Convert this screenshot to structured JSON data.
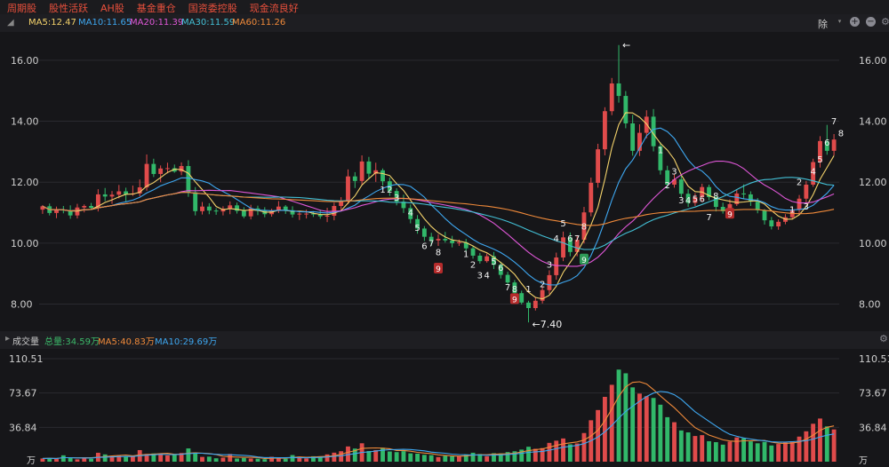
{
  "tags": [
    "周期股",
    "股性活跃",
    "AH股",
    "基金重仓",
    "国资委控股",
    "现金流良好"
  ],
  "ma_legend": [
    {
      "label": "MA5:12.47",
      "color": "#f5d36b"
    },
    {
      "label": "MA10:11.65",
      "color": "#3ea7f0"
    },
    {
      "label": "MA20:11.39",
      "color": "#e057d8"
    },
    {
      "label": "MA30:11.59",
      "color": "#43c0d6"
    },
    {
      "label": "MA60:11.26",
      "color": "#f08a3a"
    }
  ],
  "toolbar": {
    "adjust_label": "除"
  },
  "volume_legend": {
    "title": "成交量",
    "items": [
      {
        "label": "总量:34.59万",
        "color": "#3cba6a"
      },
      {
        "label": "MA5:40.83万",
        "color": "#f08a3a"
      },
      {
        "label": "MA10:29.69万",
        "color": "#3ea7f0"
      }
    ]
  },
  "chart_data": {
    "type": "candlestick",
    "price_ticks": [
      "16.00",
      "14.00",
      "12.00",
      "10.00",
      "8.00"
    ],
    "price_range": [
      7.2,
      16.9
    ],
    "volume_ticks": [
      "110.51",
      "73.67",
      "36.84"
    ],
    "volume_unit": "万",
    "volume_range": [
      0,
      120
    ],
    "annotations": {
      "low": "←7.40",
      "high": "←"
    },
    "seq_labels": [
      {
        "i": 49,
        "p": 11.65,
        "t": "1"
      },
      {
        "i": 50,
        "p": 11.65,
        "t": "2"
      },
      {
        "i": 51,
        "p": 11.4,
        "t": "3"
      },
      {
        "i": 53,
        "p": 10.9,
        "t": "4"
      },
      {
        "i": 54,
        "p": 10.4,
        "t": "5"
      },
      {
        "i": 55,
        "p": 9.8,
        "t": "6"
      },
      {
        "i": 56,
        "p": 9.9,
        "t": "7"
      },
      {
        "i": 57,
        "p": 9.6,
        "t": "8"
      },
      {
        "i": 61,
        "p": 9.55,
        "t": "1"
      },
      {
        "i": 62,
        "p": 9.2,
        "t": "2"
      },
      {
        "i": 63,
        "p": 8.85,
        "t": "3"
      },
      {
        "i": 64,
        "p": 8.85,
        "t": "4"
      },
      {
        "i": 65,
        "p": 9.3,
        "t": "5"
      },
      {
        "i": 66,
        "p": 9.1,
        "t": "6"
      },
      {
        "i": 67,
        "p": 8.45,
        "t": "7"
      },
      {
        "i": 68,
        "p": 8.4,
        "t": "8"
      },
      {
        "i": 70,
        "p": 8.4,
        "t": "1"
      },
      {
        "i": 72,
        "p": 8.55,
        "t": "2"
      },
      {
        "i": 73,
        "p": 9.2,
        "t": "3"
      },
      {
        "i": 74,
        "p": 10.05,
        "t": "4"
      },
      {
        "i": 75,
        "p": 10.55,
        "t": "5"
      },
      {
        "i": 76,
        "p": 10.05,
        "t": "6"
      },
      {
        "i": 77,
        "p": 10.05,
        "t": "7"
      },
      {
        "i": 78,
        "p": 10.45,
        "t": "8"
      },
      {
        "i": 89,
        "p": 12.95,
        "t": "1"
      },
      {
        "i": 90,
        "p": 11.8,
        "t": "2"
      },
      {
        "i": 91,
        "p": 12.25,
        "t": "3"
      },
      {
        "i": 92,
        "p": 11.3,
        "t": "3"
      },
      {
        "i": 93,
        "p": 11.3,
        "t": "4"
      },
      {
        "i": 94,
        "p": 11.35,
        "t": "5"
      },
      {
        "i": 95,
        "p": 11.35,
        "t": "6"
      },
      {
        "i": 96,
        "p": 10.75,
        "t": "7"
      },
      {
        "i": 97,
        "p": 11.45,
        "t": "8"
      },
      {
        "i": 108,
        "p": 11.0,
        "t": "1"
      },
      {
        "i": 109,
        "p": 11.9,
        "t": "2"
      },
      {
        "i": 110,
        "p": 11.1,
        "t": "3"
      },
      {
        "i": 111,
        "p": 12.25,
        "t": "4"
      },
      {
        "i": 112,
        "p": 12.65,
        "t": "5"
      },
      {
        "i": 113,
        "p": 13.2,
        "t": "6"
      },
      {
        "i": 114,
        "p": 13.9,
        "t": "7"
      },
      {
        "i": 115,
        "p": 13.5,
        "t": "8"
      }
    ],
    "badge9": [
      {
        "i": 57,
        "p": 9.15,
        "c": "#b52b2b",
        "t": "9"
      },
      {
        "i": 68,
        "p": 8.15,
        "c": "#b52b2b",
        "t": "9"
      },
      {
        "i": 78,
        "p": 9.45,
        "c": "#2f9a58",
        "t": "9"
      },
      {
        "i": 99,
        "p": 10.95,
        "c": "#b52b2b",
        "t": "9"
      }
    ],
    "candles": [
      {
        "o": 11.1,
        "h": 11.25,
        "l": 10.96,
        "c": 11.21,
        "v": 3.42
      },
      {
        "o": 11.21,
        "h": 11.3,
        "l": 10.91,
        "c": 10.99,
        "v": 3.79
      },
      {
        "o": 10.99,
        "h": 11.2,
        "l": 10.82,
        "c": 11.1,
        "v": 3.15
      },
      {
        "o": 11.1,
        "h": 11.22,
        "l": 10.98,
        "c": 11.08,
        "v": 6.82
      },
      {
        "o": 11.08,
        "h": 11.24,
        "l": 10.8,
        "c": 10.91,
        "v": 4.12
      },
      {
        "o": 10.91,
        "h": 11.29,
        "l": 10.81,
        "c": 11.17,
        "v": 2.5
      },
      {
        "o": 11.17,
        "h": 11.27,
        "l": 11.01,
        "c": 11.22,
        "v": 4.37
      },
      {
        "o": 11.22,
        "h": 11.32,
        "l": 11.1,
        "c": 11.16,
        "v": 3.08
      },
      {
        "o": 11.16,
        "h": 11.77,
        "l": 11.04,
        "c": 11.6,
        "v": 9.55
      },
      {
        "o": 11.6,
        "h": 11.81,
        "l": 11.38,
        "c": 11.53,
        "v": 7.8
      },
      {
        "o": 11.53,
        "h": 11.71,
        "l": 11.29,
        "c": 11.59,
        "v": 5.93
      },
      {
        "o": 11.59,
        "h": 11.91,
        "l": 11.47,
        "c": 11.7,
        "v": 6.9
      },
      {
        "o": 11.7,
        "h": 11.82,
        "l": 11.37,
        "c": 11.6,
        "v": 5.31
      },
      {
        "o": 11.6,
        "h": 11.89,
        "l": 11.55,
        "c": 11.63,
        "v": 5.54
      },
      {
        "o": 11.63,
        "h": 12.09,
        "l": 11.53,
        "c": 11.83,
        "v": 12.4
      },
      {
        "o": 11.83,
        "h": 12.91,
        "l": 11.72,
        "c": 12.6,
        "v": 8.32
      },
      {
        "o": 12.6,
        "h": 12.77,
        "l": 12.17,
        "c": 12.27,
        "v": 8.84
      },
      {
        "o": 12.27,
        "h": 12.55,
        "l": 12.0,
        "c": 12.45,
        "v": 8.41
      },
      {
        "o": 12.45,
        "h": 12.64,
        "l": 12.29,
        "c": 12.46,
        "v": 6.73
      },
      {
        "o": 12.46,
        "h": 12.58,
        "l": 12.31,
        "c": 12.35,
        "v": 7.15
      },
      {
        "o": 12.35,
        "h": 12.65,
        "l": 12.23,
        "c": 12.53,
        "v": 9.29
      },
      {
        "o": 12.53,
        "h": 12.72,
        "l": 11.52,
        "c": 11.67,
        "v": 14.21
      },
      {
        "o": 11.67,
        "h": 11.84,
        "l": 10.91,
        "c": 11.05,
        "v": 9.87
      },
      {
        "o": 11.05,
        "h": 11.35,
        "l": 10.94,
        "c": 11.2,
        "v": 5.12
      },
      {
        "o": 11.2,
        "h": 11.31,
        "l": 10.95,
        "c": 11.07,
        "v": 5.43
      },
      {
        "o": 11.07,
        "h": 11.15,
        "l": 10.93,
        "c": 11.04,
        "v": 3.64
      },
      {
        "o": 11.04,
        "h": 11.21,
        "l": 10.91,
        "c": 11.13,
        "v": 4.32
      },
      {
        "o": 11.13,
        "h": 11.37,
        "l": 10.95,
        "c": 11.24,
        "v": 8.24
      },
      {
        "o": 11.24,
        "h": 11.33,
        "l": 10.97,
        "c": 11.06,
        "v": 3.37
      },
      {
        "o": 11.06,
        "h": 11.18,
        "l": 10.82,
        "c": 10.88,
        "v": 3.97
      },
      {
        "o": 10.88,
        "h": 11.26,
        "l": 10.78,
        "c": 11.14,
        "v": 3.41
      },
      {
        "o": 11.14,
        "h": 11.23,
        "l": 10.92,
        "c": 11.06,
        "v": 3.21
      },
      {
        "o": 11.06,
        "h": 11.18,
        "l": 10.85,
        "c": 10.95,
        "v": 2.7
      },
      {
        "o": 10.95,
        "h": 11.13,
        "l": 10.87,
        "c": 11.06,
        "v": 5.23
      },
      {
        "o": 11.06,
        "h": 11.38,
        "l": 10.99,
        "c": 11.2,
        "v": 4.14
      },
      {
        "o": 11.2,
        "h": 11.25,
        "l": 10.96,
        "c": 11.08,
        "v": 3.15
      },
      {
        "o": 11.08,
        "h": 11.21,
        "l": 10.84,
        "c": 10.94,
        "v": 7.1
      },
      {
        "o": 10.94,
        "h": 11.05,
        "l": 10.76,
        "c": 10.97,
        "v": 5.41
      },
      {
        "o": 10.97,
        "h": 11.1,
        "l": 10.81,
        "c": 10.97,
        "v": 3.54
      },
      {
        "o": 10.97,
        "h": 11.05,
        "l": 10.86,
        "c": 10.95,
        "v": 5.8
      },
      {
        "o": 10.95,
        "h": 11.1,
        "l": 10.8,
        "c": 10.88,
        "v": 5.34
      },
      {
        "o": 10.88,
        "h": 11.16,
        "l": 10.69,
        "c": 10.9,
        "v": 7.8
      },
      {
        "o": 10.9,
        "h": 11.33,
        "l": 10.75,
        "c": 11.22,
        "v": 9.66
      },
      {
        "o": 11.22,
        "h": 11.51,
        "l": 11.09,
        "c": 11.39,
        "v": 11.2
      },
      {
        "o": 11.39,
        "h": 12.42,
        "l": 11.28,
        "c": 12.19,
        "v": 16.32
      },
      {
        "o": 12.19,
        "h": 12.33,
        "l": 11.81,
        "c": 12.04,
        "v": 14.07
      },
      {
        "o": 12.04,
        "h": 12.88,
        "l": 11.92,
        "c": 12.68,
        "v": 19.74
      },
      {
        "o": 12.68,
        "h": 12.83,
        "l": 12.09,
        "c": 12.28,
        "v": 11.42
      },
      {
        "o": 12.28,
        "h": 12.64,
        "l": 12.01,
        "c": 12.39,
        "v": 12.41
      },
      {
        "o": 12.39,
        "h": 12.45,
        "l": 11.89,
        "c": 12.03,
        "v": 14.92
      },
      {
        "o": 12.03,
        "h": 12.15,
        "l": 11.55,
        "c": 11.71,
        "v": 10.93
      },
      {
        "o": 11.71,
        "h": 11.8,
        "l": 11.24,
        "c": 11.36,
        "v": 10.26
      },
      {
        "o": 11.36,
        "h": 11.59,
        "l": 10.99,
        "c": 11.15,
        "v": 11.3
      },
      {
        "o": 11.15,
        "h": 11.27,
        "l": 10.65,
        "c": 10.79,
        "v": 8.92
      },
      {
        "o": 10.79,
        "h": 10.92,
        "l": 10.31,
        "c": 10.48,
        "v": 8.57
      },
      {
        "o": 10.48,
        "h": 10.56,
        "l": 10.07,
        "c": 10.21,
        "v": 7.34
      },
      {
        "o": 10.21,
        "h": 10.34,
        "l": 9.91,
        "c": 10.09,
        "v": 6.97
      },
      {
        "o": 10.09,
        "h": 10.29,
        "l": 9.91,
        "c": 10.14,
        "v": 4.93
      },
      {
        "o": 10.14,
        "h": 10.37,
        "l": 10.02,
        "c": 10.09,
        "v": 6.21
      },
      {
        "o": 10.09,
        "h": 10.24,
        "l": 9.86,
        "c": 10.0,
        "v": 5.8
      },
      {
        "o": 10.0,
        "h": 10.12,
        "l": 9.91,
        "c": 10.03,
        "v": 5.69
      },
      {
        "o": 10.03,
        "h": 10.14,
        "l": 9.74,
        "c": 9.83,
        "v": 7.91
      },
      {
        "o": 9.83,
        "h": 9.92,
        "l": 9.49,
        "c": 9.59,
        "v": 9.59
      },
      {
        "o": 9.59,
        "h": 9.68,
        "l": 9.33,
        "c": 9.41,
        "v": 8.23
      },
      {
        "o": 9.41,
        "h": 9.66,
        "l": 9.36,
        "c": 9.57,
        "v": 5.8
      },
      {
        "o": 9.57,
        "h": 9.71,
        "l": 9.15,
        "c": 9.29,
        "v": 9.08
      },
      {
        "o": 9.29,
        "h": 9.39,
        "l": 8.84,
        "c": 8.96,
        "v": 8.87
      },
      {
        "o": 8.96,
        "h": 9.06,
        "l": 8.63,
        "c": 8.71,
        "v": 10.29
      },
      {
        "o": 8.71,
        "h": 8.79,
        "l": 8.24,
        "c": 8.36,
        "v": 11.15
      },
      {
        "o": 8.36,
        "h": 8.44,
        "l": 7.99,
        "c": 8.05,
        "v": 12.94
      },
      {
        "o": 8.05,
        "h": 8.11,
        "l": 7.4,
        "c": 7.87,
        "v": 16.02
      },
      {
        "o": 7.87,
        "h": 8.22,
        "l": 7.79,
        "c": 8.11,
        "v": 13.81
      },
      {
        "o": 8.11,
        "h": 8.59,
        "l": 8.02,
        "c": 8.46,
        "v": 14.56
      },
      {
        "o": 8.46,
        "h": 9.11,
        "l": 8.33,
        "c": 8.95,
        "v": 20.17
      },
      {
        "o": 8.95,
        "h": 9.69,
        "l": 8.8,
        "c": 9.53,
        "v": 22.5
      },
      {
        "o": 9.53,
        "h": 10.38,
        "l": 9.41,
        "c": 10.19,
        "v": 24.89
      },
      {
        "o": 10.19,
        "h": 10.35,
        "l": 9.57,
        "c": 9.71,
        "v": 18.61
      },
      {
        "o": 9.71,
        "h": 10.26,
        "l": 9.57,
        "c": 10.11,
        "v": 19.52
      },
      {
        "o": 10.11,
        "h": 11.19,
        "l": 9.99,
        "c": 11.01,
        "v": 30.72
      },
      {
        "o": 11.01,
        "h": 12.15,
        "l": 10.88,
        "c": 11.98,
        "v": 44.41
      },
      {
        "o": 11.98,
        "h": 13.26,
        "l": 11.82,
        "c": 13.08,
        "v": 55.4
      },
      {
        "o": 13.08,
        "h": 14.46,
        "l": 12.88,
        "c": 14.33,
        "v": 69.53
      },
      {
        "o": 14.33,
        "h": 15.42,
        "l": 14.2,
        "c": 15.24,
        "v": 82.44
      },
      {
        "o": 15.24,
        "h": 16.5,
        "l": 14.61,
        "c": 14.83,
        "v": 98.77
      },
      {
        "o": 14.83,
        "h": 14.99,
        "l": 13.77,
        "c": 13.93,
        "v": 94.8
      },
      {
        "o": 13.93,
        "h": 14.21,
        "l": 12.87,
        "c": 13.03,
        "v": 79.71
      },
      {
        "o": 13.03,
        "h": 13.9,
        "l": 12.86,
        "c": 13.62,
        "v": 73.03
      },
      {
        "o": 13.62,
        "h": 14.36,
        "l": 13.44,
        "c": 14.15,
        "v": 70.21
      },
      {
        "o": 14.15,
        "h": 14.4,
        "l": 13.01,
        "c": 13.18,
        "v": 68.35
      },
      {
        "o": 13.18,
        "h": 13.31,
        "l": 12.25,
        "c": 12.39,
        "v": 61.12
      },
      {
        "o": 12.39,
        "h": 12.54,
        "l": 11.79,
        "c": 11.92,
        "v": 47.73
      },
      {
        "o": 11.92,
        "h": 12.26,
        "l": 11.82,
        "c": 12.09,
        "v": 42.33
      },
      {
        "o": 12.09,
        "h": 12.25,
        "l": 11.49,
        "c": 11.62,
        "v": 33.49
      },
      {
        "o": 11.62,
        "h": 11.77,
        "l": 11.19,
        "c": 11.32,
        "v": 31.41
      },
      {
        "o": 11.32,
        "h": 11.64,
        "l": 11.22,
        "c": 11.51,
        "v": 27.54
      },
      {
        "o": 11.51,
        "h": 11.95,
        "l": 11.36,
        "c": 11.84,
        "v": 28.46
      },
      {
        "o": 11.84,
        "h": 11.92,
        "l": 11.41,
        "c": 11.51,
        "v": 21.95
      },
      {
        "o": 11.51,
        "h": 11.57,
        "l": 11.04,
        "c": 11.19,
        "v": 20.94
      },
      {
        "o": 11.19,
        "h": 11.33,
        "l": 10.97,
        "c": 11.05,
        "v": 18.25
      },
      {
        "o": 11.05,
        "h": 11.44,
        "l": 10.96,
        "c": 11.28,
        "v": 21.51
      },
      {
        "o": 11.28,
        "h": 11.75,
        "l": 11.22,
        "c": 11.63,
        "v": 26.03
      },
      {
        "o": 11.63,
        "h": 11.93,
        "l": 11.45,
        "c": 11.6,
        "v": 25.09
      },
      {
        "o": 11.6,
        "h": 11.7,
        "l": 11.22,
        "c": 11.36,
        "v": 21.73
      },
      {
        "o": 11.36,
        "h": 11.48,
        "l": 10.98,
        "c": 11.08,
        "v": 19.71
      },
      {
        "o": 11.08,
        "h": 11.12,
        "l": 10.61,
        "c": 10.75,
        "v": 21.22
      },
      {
        "o": 10.75,
        "h": 10.86,
        "l": 10.45,
        "c": 10.55,
        "v": 17.37
      },
      {
        "o": 10.55,
        "h": 10.78,
        "l": 10.44,
        "c": 10.7,
        "v": 18.95
      },
      {
        "o": 10.7,
        "h": 10.95,
        "l": 10.62,
        "c": 10.85,
        "v": 20.52
      },
      {
        "o": 10.85,
        "h": 11.18,
        "l": 10.78,
        "c": 11.09,
        "v": 21.88
      },
      {
        "o": 11.09,
        "h": 11.58,
        "l": 10.95,
        "c": 11.46,
        "v": 26.89
      },
      {
        "o": 11.46,
        "h": 12.04,
        "l": 11.34,
        "c": 11.92,
        "v": 32.57
      },
      {
        "o": 11.92,
        "h": 12.77,
        "l": 11.85,
        "c": 12.66,
        "v": 40.68
      },
      {
        "o": 12.66,
        "h": 13.51,
        "l": 12.48,
        "c": 13.35,
        "v": 46.29
      },
      {
        "o": 13.35,
        "h": 13.88,
        "l": 12.9,
        "c": 13.03,
        "v": 37.83
      },
      {
        "o": 13.03,
        "h": 13.58,
        "l": 12.88,
        "c": 13.4,
        "v": 34.59
      }
    ]
  }
}
